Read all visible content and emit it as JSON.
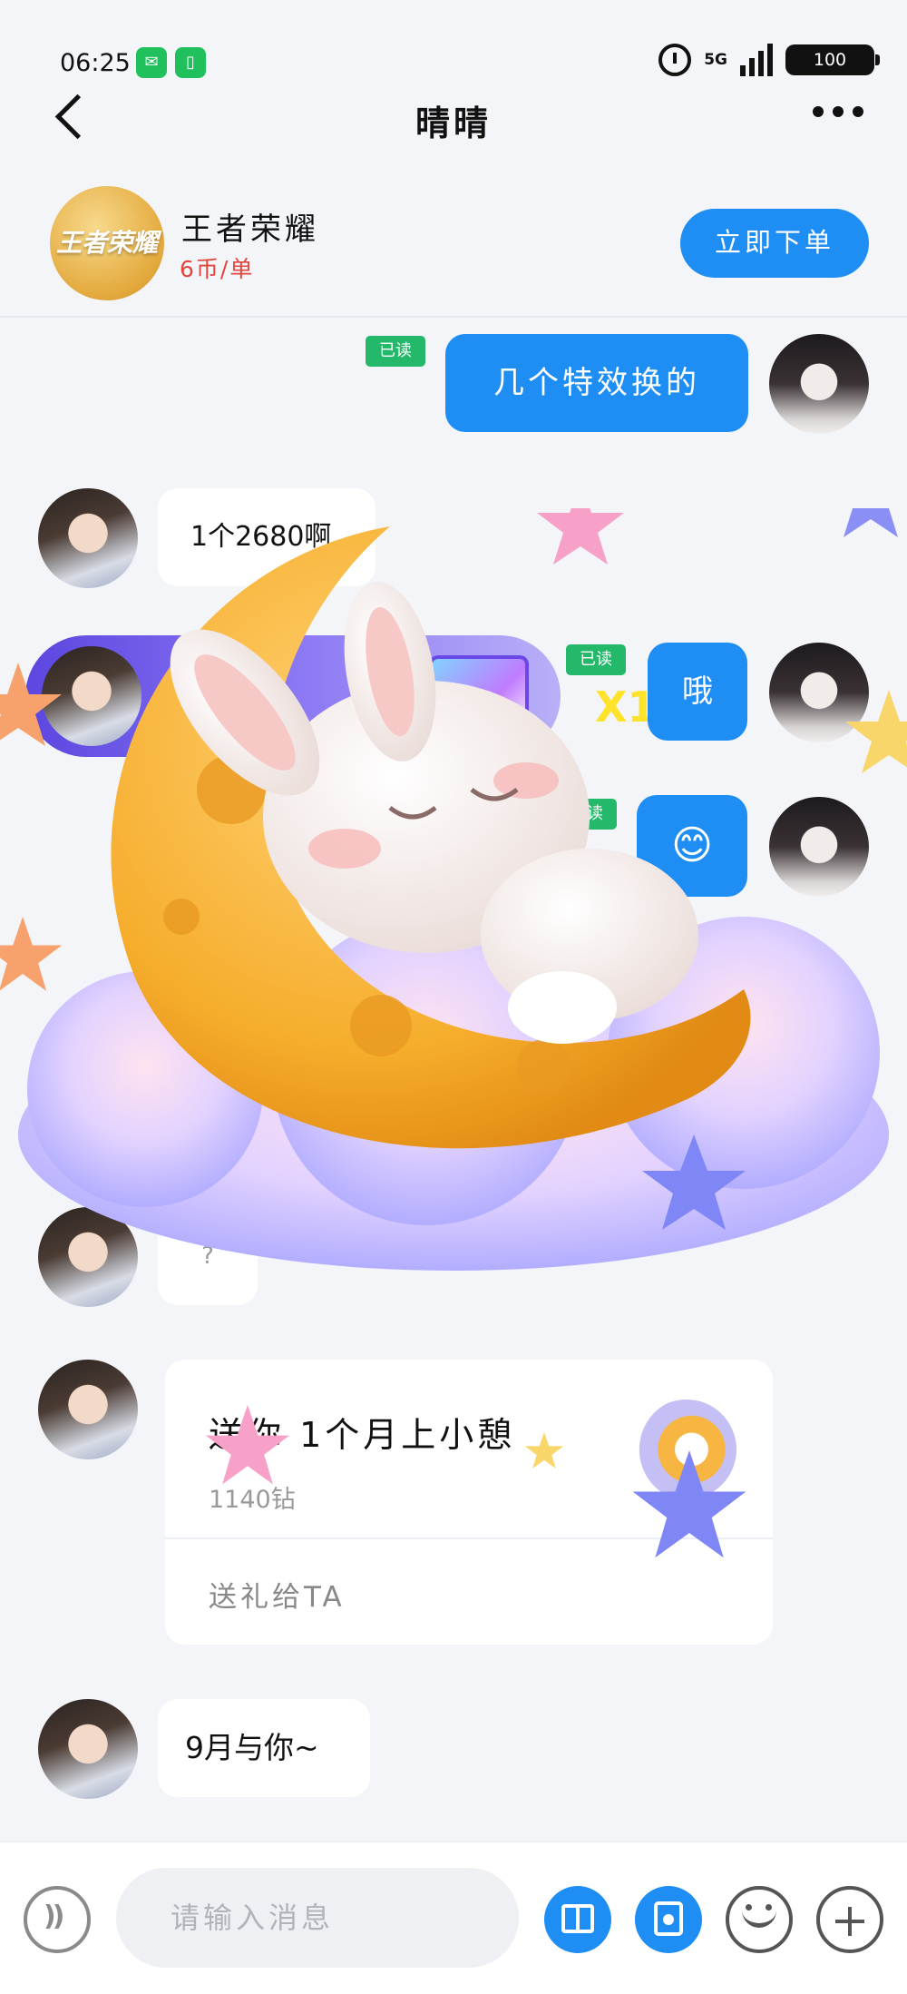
{
  "status_bar": {
    "time": "06:25",
    "network": "5G",
    "battery": "100"
  },
  "nav": {
    "title": "晴晴"
  },
  "game_card": {
    "logo_text": "王者荣耀",
    "name": "王者荣耀",
    "price": "6币/单",
    "order_button": "立即下单"
  },
  "messages": {
    "m1": {
      "text": "几个特效换的",
      "read": "已读"
    },
    "m2": {
      "text": "1个2680啊"
    },
    "m3": {
      "text": "哦",
      "read": "已读"
    },
    "m4": {
      "text": "😊",
      "read": "已读"
    },
    "m5": {
      "text": "?"
    },
    "m7": {
      "text": "9月与你~"
    }
  },
  "gift_banner": {
    "count": "X1"
  },
  "gift_card": {
    "title": "送你 1个月上小憩",
    "sub": "1140钻",
    "send_label": "送礼给TA"
  },
  "input": {
    "placeholder": "请输入消息"
  },
  "colors": {
    "accent": "#1e8ef5",
    "read_tag": "#23b86a",
    "price": "#e2453c"
  }
}
